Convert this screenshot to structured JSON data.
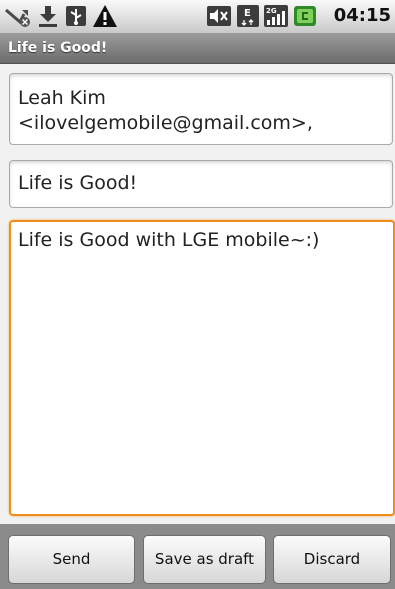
{
  "status_bar": {
    "time": "04:15",
    "icons": [
      "missed-call-icon",
      "download-icon",
      "usb-icon",
      "warning-icon",
      "mute-icon",
      "edge-data-icon",
      "signal-2g-icon",
      "battery-charging-icon"
    ]
  },
  "title_bar": {
    "title": "Life is Good!"
  },
  "compose": {
    "to_value": "Leah Kim <ilovelgemobile@gmail.com>,",
    "subject_value": "Life is Good!",
    "body_value": "Life is Good with LGE mobile~:)"
  },
  "actions": {
    "send_label": "Send",
    "save_draft_label": "Save as draft",
    "discard_label": "Discard"
  },
  "colors": {
    "focus": "#f08c1a",
    "button_bar": "#8b8b8b"
  }
}
